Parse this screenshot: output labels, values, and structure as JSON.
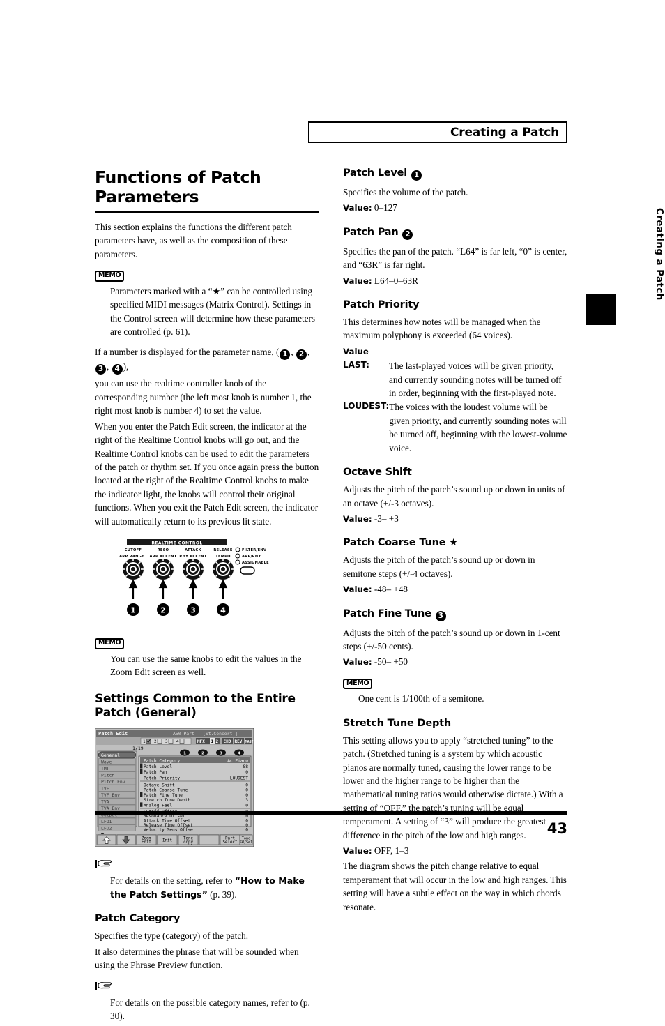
{
  "header": {
    "title": "Creating a Patch"
  },
  "side_tab": {
    "label": "Creating a Patch"
  },
  "footer": {
    "page_number": "43"
  },
  "left_column": {
    "main_title": "Functions of Patch Parameters",
    "intro": "This section explains the functions the different patch parameters have, as well as the composition of these parameters.",
    "memo1": {
      "icon_label": "MEMO",
      "text": "Parameters marked with a “★” can be controlled using specified MIDI messages (Matrix Control). Settings in the Control screen will determine how these parameters are controlled (p. 61)."
    },
    "para_numbers_prefix": "If a number is displayed for the parameter name, (",
    "para_numbers_suffix": "),",
    "para_numbers_rest": "you can use the realtime controller knob of the corresponding number (the left most knob is number 1, the right most knob is number 4) to set the value.",
    "para_patch_edit": "When you enter the Patch Edit screen, the indicator at the right of the Realtime Control knobs will go out, and the Realtime Control knobs can be used to edit the parameters of the patch or rhythm set. If you once again press the button located at the right of the Realtime Control knobs to make the indicator light, the knobs will control their original functions. When you exit the Patch Edit screen, the indicator will automatically return to its previous lit state.",
    "memo2": {
      "icon_label": "MEMO",
      "text": "You can use the same knobs to edit the values in the Zoom Edit screen as well."
    },
    "section_title": "Settings Common to the Entire Patch (General)",
    "refer1": {
      "text_before": "For details on the setting, refer to ",
      "bold_text": "“How to Make the Patch Settings”",
      "text_after": " (p. 39)."
    },
    "patch_category": {
      "heading": "Patch Category",
      "p1": "Specifies the type (category) of the patch.",
      "p2": "It also determines the phrase that will be sounded when using the Phrase Preview function."
    },
    "refer2": {
      "text": "For details on the possible category names, refer to (p. 30)."
    }
  },
  "realtime_panel": {
    "title": "REALTIME CONTROL",
    "knobs": [
      {
        "top_label": "CUTOFF",
        "bottom_label": "ARP RANGE",
        "number": "1"
      },
      {
        "top_label": "RESO",
        "bottom_label": "ARP ACCENT",
        "number": "2"
      },
      {
        "top_label": "ATTACK",
        "bottom_label": "RHY ACCENT",
        "number": "3"
      },
      {
        "top_label": "RELEASE",
        "bottom_label": "TEMPO",
        "number": "4"
      }
    ],
    "indicators": [
      "FILTER/ENV",
      "ARP/RHY",
      "ASSIGNABLE"
    ]
  },
  "lcd": {
    "title": "Patch Edit",
    "part": "A50 Part",
    "patch_name": "[St.Concert  ]",
    "page_counter": "1/19",
    "tone_switches": [
      "1",
      "2",
      "3",
      "4"
    ],
    "effect_tabs": [
      "MFX",
      "1",
      "2",
      "CHO",
      "REV",
      "MASTER"
    ],
    "knob_markers": [
      "1",
      "2",
      "3",
      "4"
    ],
    "menu_items": [
      "General",
      "Wave",
      "TMT",
      "Pitch",
      "Pitch Env",
      "TVF",
      "TVF Env",
      "TVA",
      "TVA Env",
      "Output",
      "LFO1",
      "LFO2"
    ],
    "selected_menu": "General",
    "param_groups": [
      {
        "rows": [
          {
            "name": "Patch Category",
            "value": "Ac.Piano",
            "marker": "",
            "selected": true
          },
          {
            "name": "Patch Level",
            "value": "88",
            "marker": "1",
            "selected": false
          },
          {
            "name": "Patch Pan",
            "value": "0",
            "marker": "2",
            "selected": false
          },
          {
            "name": "Patch Priority",
            "value": "LOUDEST",
            "marker": "",
            "selected": false
          }
        ]
      },
      {
        "rows": [
          {
            "name": "Octave Shift",
            "value": "0",
            "marker": "",
            "selected": false
          },
          {
            "name": "Patch Coarse Tune",
            "value": "0",
            "marker": "",
            "selected": false
          },
          {
            "name": "Patch Fine Tune",
            "value": "0",
            "marker": "3",
            "selected": false
          },
          {
            "name": "Stretch Tune Depth",
            "value": "3",
            "marker": "",
            "selected": false
          },
          {
            "name": "Analog Feel",
            "value": "0",
            "marker": "4",
            "selected": false
          }
        ]
      },
      {
        "rows": [
          {
            "name": "Cutoff Offset",
            "value": "0",
            "marker": "",
            "selected": false
          },
          {
            "name": "Resonance Offset",
            "value": "0",
            "marker": "",
            "selected": false
          },
          {
            "name": "Attack Time Offset",
            "value": "0",
            "marker": "",
            "selected": false
          },
          {
            "name": "Release Time Offset",
            "value": "0",
            "marker": "",
            "selected": false
          },
          {
            "name": "Velocity Sens Offset",
            "value": "0",
            "marker": "",
            "selected": false
          }
        ]
      }
    ],
    "function_buttons": [
      {
        "line1": "↑",
        "line2": ""
      },
      {
        "line1": "↓",
        "line2": ""
      },
      {
        "line1": "Zoom",
        "line2": "Edit"
      },
      {
        "line1": "Init",
        "line2": ""
      },
      {
        "line1": "Tone",
        "line2": "copy"
      },
      {
        "line1": "",
        "line2": ""
      },
      {
        "line1": "Part",
        "line2": "Select"
      },
      {
        "line1": "Tone",
        "line2": "SW/Sel"
      }
    ]
  },
  "right_column": {
    "patch_level": {
      "heading": "Patch Level",
      "number": "1",
      "desc": "Specifies the volume of the patch.",
      "value_label": "Value:",
      "value": "0–127"
    },
    "patch_pan": {
      "heading": "Patch Pan",
      "number": "2",
      "desc": "Specifies the pan of the patch. “L64” is far left, “0” is center, and “63R” is far right.",
      "value_label": "Value:",
      "value": "L64–0–63R"
    },
    "patch_priority": {
      "heading": "Patch Priority",
      "desc": "This determines how notes will be managed when the maximum polyphony is exceeded (64 voices).",
      "value_label": "Value",
      "options": [
        {
          "term": "LAST:",
          "desc": "The last-played voices will be given priority, and currently sounding notes will be turned off in order, beginning with the first-played note."
        },
        {
          "term": "LOUDEST:",
          "desc": "The voices with the loudest volume will be given priority, and currently sounding notes will be turned off, beginning with the lowest-volume voice."
        }
      ]
    },
    "octave_shift": {
      "heading": "Octave Shift",
      "desc": "Adjusts the pitch of the patch’s sound up or down in units of an octave (+/-3 octaves).",
      "value_label": "Value:",
      "value": "-3– +3"
    },
    "patch_coarse_tune": {
      "heading": "Patch Coarse Tune",
      "star": "★",
      "desc": "Adjusts the pitch of the patch’s sound up or down in semitone steps (+/-4 octaves).",
      "value_label": "Value:",
      "value": "-48– +48"
    },
    "patch_fine_tune": {
      "heading": "Patch Fine Tune",
      "number": "3",
      "desc": "Adjusts the pitch of the patch’s sound up or down in 1-cent steps (+/-50 cents).",
      "value_label": "Value:",
      "value": "-50– +50",
      "memo": {
        "icon_label": "MEMO",
        "text": "One cent is 1/100th of a semitone."
      }
    },
    "stretch_tune_depth": {
      "heading": "Stretch Tune Depth",
      "desc": "This setting allows you to apply “stretched tuning” to the patch. (Stretched tuning is a system by which acoustic pianos are normally tuned, causing the lower range to be lower and the higher range to be higher than the mathematical tuning ratios would otherwise dictate.) With a setting of “OFF,” the patch’s tuning will be equal temperament. A setting of “3” will produce the greatest difference in the pitch of the low and high ranges.",
      "value_label": "Value:",
      "value": "OFF, 1–3",
      "desc2": "The diagram shows the pitch change relative to equal temperament that will occur in the low and high ranges. This setting will have a subtle effect on the way in which chords resonate."
    }
  }
}
